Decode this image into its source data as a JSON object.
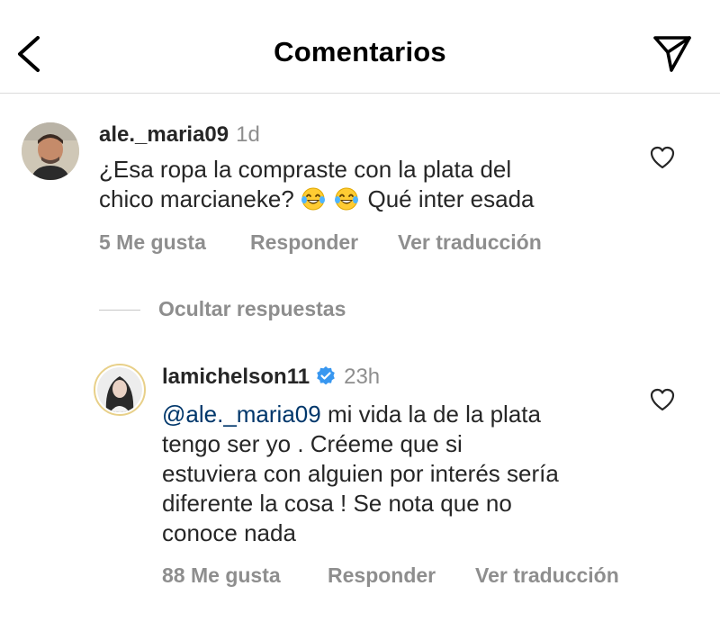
{
  "header": {
    "title": "Comentarios",
    "back_icon": "chevron-left-icon",
    "share_icon": "paper-plane-icon"
  },
  "comment": {
    "username": "ale._maria09",
    "time": "1d",
    "text_line1": "¿Esa ropa la compraste con la plata del",
    "text_line2_pre": "chico marcianeke?",
    "text_line2_post": "Qué inter esada",
    "emoji": "face-with-tears-of-joy",
    "likes": "5 Me gusta",
    "reply": "Responder",
    "translate": "Ver traducción"
  },
  "hide_replies": "Ocultar respuestas",
  "reply": {
    "username": "lamichelson11",
    "time": "23h",
    "verified": true,
    "mention": "@ale._maria09",
    "text_line1_rest": " mi vida la de la plata",
    "text_line2": "tengo ser yo . Créeme que si",
    "text_line3": "estuviera con alguien por interés sería",
    "text_line4": "diferente la cosa ! Se nota que no",
    "text_line5": "conoce nada",
    "likes": "88 Me gusta",
    "reply": "Responder",
    "translate": "Ver traducción"
  },
  "colors": {
    "text": "#262626",
    "muted": "#8e8e8e",
    "mention": "#00376b",
    "verified": "#3897f0",
    "divider": "#dbdbdb"
  }
}
